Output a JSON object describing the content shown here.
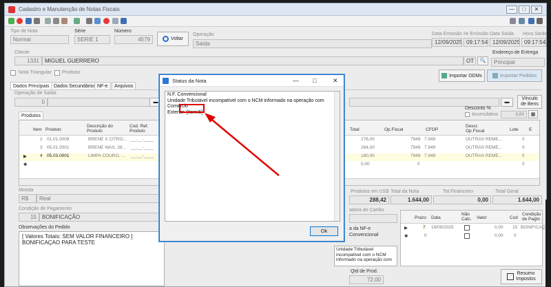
{
  "window": {
    "title": "Cadastro e Manutenção de Notas Fiscais"
  },
  "header": {
    "tipo_label": "Tipo de Nota",
    "tipo_value": "Normal",
    "serie_label": "Série",
    "serie_value": "SERIE 1",
    "numero_label": "Número",
    "numero_value": "4579",
    "voltar_label": "Voltar",
    "operacao_label": "Operação",
    "operacao_value": "Saída",
    "data_emissao_label": "Data Emissão",
    "data_emissao_value": "12/09/2025",
    "hr_emissao_label": "Hr Emissão",
    "hr_emissao_value": "09:17:54",
    "data_saida_label": "Data Saída",
    "data_saida_value": "12/09/2025",
    "hora_saida_label": "Hora Saída",
    "hora_saida_value": "09:17:54"
  },
  "cliente": {
    "label": "Cliente",
    "code": "1331",
    "name": "MIGUEL GUERRERO",
    "ot": "OT",
    "endereco_label": "Endereço de Entrega",
    "endereco_value": "Principal"
  },
  "checks": {
    "triangular": "Nota Triangular",
    "produtor": "Produtor"
  },
  "import_buttons": {
    "odms": "Importar ODMs",
    "pedidos": "Importar Pedidos"
  },
  "tabs": [
    "Dados Principais",
    "Dados Secundários",
    "NF-e",
    "Arquivos"
  ],
  "operacao_saida": {
    "label": "Operação de Saída",
    "value": "0"
  },
  "vinculo": "Vínculo de Bens",
  "desconto": {
    "label": "Desconto %",
    "acumulativo": "Acumulativo",
    "value": "0,00"
  },
  "produtos_tab": "Produtos",
  "grid": {
    "headers": [
      "Item",
      "Produto",
      "Descrição do Produto",
      "Cod. Ref. Produto"
    ],
    "headers_right": [
      "Total",
      "Op.Fiscal",
      "CFOP",
      "Descr. Op.Fiscal",
      "Lote",
      "E"
    ],
    "rows": [
      {
        "item": "2",
        "produto": "01.01.0009",
        "descricao": "BRENE X CITRO...",
        "ref": "__.__-____",
        "total": "276,00",
        "opf": "7949",
        "cfop": "7.949",
        "descr": "OUTRAS REME...",
        "lote": "0"
      },
      {
        "item": "3",
        "produto": "05.01.0001",
        "descricao": "BRENE WAX, 28...",
        "ref": "__.__-____",
        "total": "264,00",
        "opf": "7949",
        "cfop": "7.949",
        "descr": "OUTRAS REME...",
        "lote": "0"
      },
      {
        "item": "4",
        "produto": "05.03.0001",
        "descricao": "LIMPA COURO, ...",
        "ref": "__.__-____",
        "total": "180,00",
        "opf": "7949",
        "cfop": "7.949",
        "descr": "OUTRAS REME...",
        "lote": "0"
      },
      {
        "item": "",
        "produto": "",
        "descricao": "",
        "ref": "",
        "total": "0,00",
        "opf": "0",
        "cfop": "",
        "descr": "",
        "lote": "0"
      }
    ]
  },
  "moeda": {
    "label": "Moeda",
    "code": "R$",
    "name": "Real"
  },
  "totais": {
    "us_label": "Produtos em US$",
    "us_value": "288,42",
    "nota_label": "Total da Nota",
    "nota_value": "1.644,00",
    "fin_label": "Tot.Financeiro",
    "fin_value": "0,00",
    "geral_label": "Total Geral",
    "geral_value": "1.644,00"
  },
  "pagamento": {
    "label": "Condição de Pagamento",
    "code": "15",
    "name": "BONIFICAÇÃO"
  },
  "cartao_label": "adora do Cartão",
  "observacoes": {
    "label": "Observações do Pedido",
    "line1": "[ Valores Totais: SEM VALOR FINANCEIRO ]",
    "line2": "BONIFICAÇAO PARA TESTE"
  },
  "nfe_status": {
    "title_line1": "a da NF-e",
    "title_line2": "Convencional",
    "text": "Unidade Tributável incompatível com o NCM informado na operação com"
  },
  "qtd_prod": {
    "label": "Qtd de Prod.",
    "value": "72,00"
  },
  "parcelas": {
    "headers": [
      "Prazo",
      "Data",
      "Não Calc.",
      "Valor",
      "Cod",
      "Condição de Pagto"
    ],
    "row": {
      "prazo": "7",
      "data": "19/09/2025",
      "valor": "0,00",
      "cod": "15",
      "cond": "BONIFICAÇ"
    },
    "row2": {
      "prazo": "0",
      "valor": "0,00",
      "cod": "0"
    }
  },
  "resumo": "Resumo Impostos",
  "dialog": {
    "title": "Status da Nota",
    "line1": "N.F. Convencional",
    "line2": "Unidade Tributável incompatível com o NCM informado na operação com Comércio",
    "line3a": "Exterior.",
    "line3b": "[Item:5]",
    "ok": "Ok"
  }
}
